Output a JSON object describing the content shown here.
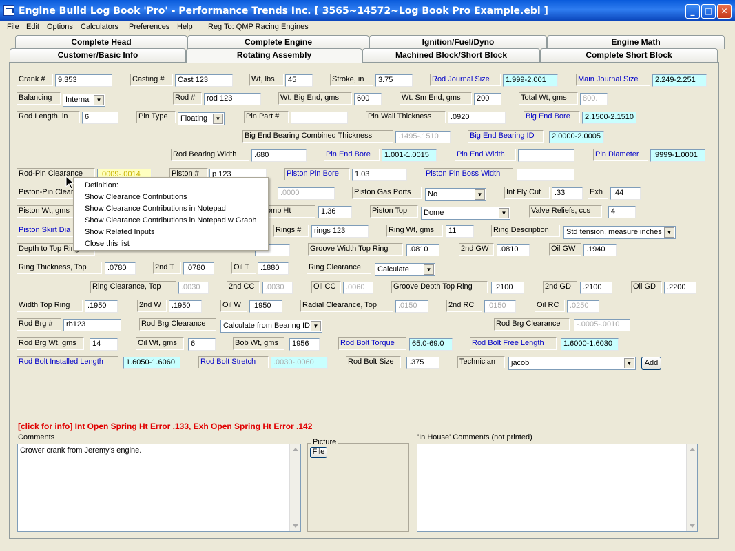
{
  "window": {
    "title": "Engine Build Log Book 'Pro' - Performance Trends Inc.   [ 3565~14572~Log Book Pro Example.ebl ]"
  },
  "menu": [
    "File",
    "Edit",
    "Options",
    "Calculators",
    "Preferences",
    "Help",
    "Reg To: QMP Racing Engines"
  ],
  "tabs_back": [
    "Complete Head",
    "Complete Engine",
    "Ignition/Fuel/Dyno",
    "Engine Math"
  ],
  "tabs_front": [
    "Customer/Basic Info",
    "Rotating Assembly",
    "Machined Block/Short Block",
    "Complete Short Block"
  ],
  "labels": [
    "Crank #",
    "Casting #",
    "Wt, lbs",
    "Stroke, in",
    "Rod Journal Size",
    "Main Journal Size",
    "Balancing",
    "Rod #",
    "Wt. Big End, gms",
    "Wt. Sm End, gms",
    "Total Wt, gms",
    "Rod Length, in",
    "Pin Type",
    "Pin Part #",
    "Pin Wall Thickness",
    "Big End Bore",
    "Big End Bearing Combined Thickness",
    "Big End Bearing ID",
    "Rod Bearing Width",
    "Pin End Bore",
    "Pin End Width",
    "Pin Diameter",
    "Rod-Pin Clearance",
    "Piston #",
    "Piston Pin Bore",
    "Piston Pin Boss Width",
    "Piston-Pin Clearance",
    "Piston Gas Ports",
    "Int Fly Cut",
    "Exh",
    "Piston Wt, gms",
    "Comp Ht",
    "Piston Top",
    "Valve Reliefs, ccs",
    "Piston Skirt Dia",
    "Rings #",
    "Ring Wt, gms",
    "Ring Description",
    "Depth to Top Ring",
    "Groove Width Top Ring",
    "2nd GW",
    "Oil GW",
    "Ring Thickness, Top",
    "2nd T",
    "Oil T",
    "Ring Clearance",
    "Ring Clearance, Top",
    "2nd CC",
    "Oil CC",
    "Groove Depth Top Ring",
    "2nd GD",
    "Oil GD",
    "Width Top Ring",
    "2nd W",
    "Oil W",
    "Radial Clearance, Top",
    "2nd RC",
    "Oil RC",
    "Rod Brg #",
    "Rod Brg Clearance",
    "Rod Brg Clearance",
    "Rod Brg Wt, gms",
    "Oil Wt, gms",
    "Bob Wt, gms",
    "Rod Bolt Torque",
    "Rod Bolt Free Length",
    "Rod Bolt Installed Length",
    "Rod Bolt Stretch",
    "Rod Bolt Size",
    "Technician"
  ],
  "fields": [
    "9.353",
    "Cast 123",
    "45",
    "3.75",
    "1.999-2.001",
    "2.249-2.251",
    "rod 123",
    "600",
    "200",
    "800.",
    "6",
    "",
    "",
    ".0920",
    "2.1500-2.1510",
    ".1495-.1510",
    "2.0000-2.0005",
    ".680",
    "1.001-1.0015",
    "",
    ".9999-1.0001",
    ".0009-.0014",
    "p 123",
    "1.03",
    "",
    ".0000",
    ".33",
    ".44",
    "1.36",
    "4",
    "rings 123",
    "11",
    "",
    "",
    "",
    "",
    ".0810",
    ".0810",
    ".1940",
    ".0780",
    ".0780",
    ".1880",
    ".0030",
    ".0030",
    ".0060",
    ".2100",
    ".2100",
    ".2200",
    ".1950",
    ".1950",
    ".1950",
    ".0150",
    ".0150",
    ".0250",
    "rb123",
    "-.0005-.0010",
    "14",
    "6",
    "1956",
    "65.0-69.0",
    "1.6000-1.6030",
    "1.6050-1.6060",
    ".0030-.0060",
    ".375"
  ],
  "selects": [
    "Internal",
    "Floating",
    "No",
    "Dome",
    "Std tension, measure inches",
    "Calculate",
    "Calculate from Bearing ID",
    "jacob"
  ],
  "buttons": {
    "add": "Add",
    "file": "File"
  },
  "status": "[click for info] Int Open Spring Ht Error .133, Exh Open Spring Ht Error .142",
  "comments": {
    "label": "Comments",
    "text": "Crower crank from Jeremy's engine.",
    "picture_label": "Picture",
    "inhouse_label": "'In House' Comments (not printed)"
  },
  "context_menu": [
    "Definition:",
    "Show Clearance Contributions",
    "Show Clearance Contributions in Notepad",
    "Show Clearance Contributions in Notepad w Graph",
    "Show Related Inputs",
    "Close this list"
  ]
}
